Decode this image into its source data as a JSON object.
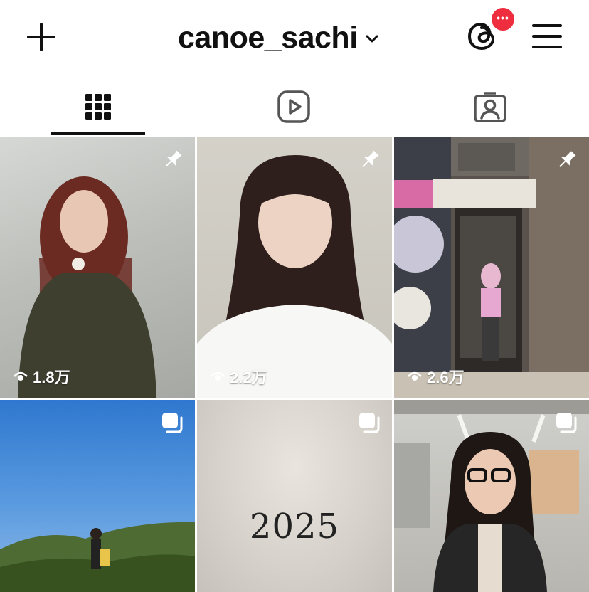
{
  "header": {
    "username": "canoe_sachi",
    "notification_badge": "•••"
  },
  "tabs": [
    {
      "name": "grid-posts",
      "active": true
    },
    {
      "name": "reels",
      "active": false
    },
    {
      "name": "tagged",
      "active": false
    }
  ],
  "grid": {
    "posts": [
      {
        "pinned": true,
        "views": "1.8万",
        "type": "photo"
      },
      {
        "pinned": true,
        "views": "2.2万",
        "type": "photo"
      },
      {
        "pinned": true,
        "views": "2.6万",
        "type": "photo"
      },
      {
        "pinned": false,
        "views": "",
        "type": "carousel"
      },
      {
        "pinned": false,
        "views": "",
        "type": "carousel",
        "text": "2025"
      },
      {
        "pinned": false,
        "views": "",
        "type": "carousel"
      }
    ]
  },
  "colors": {
    "badge": "#ee2d3e",
    "icon": "#111111",
    "tab_inactive": "#555555"
  }
}
